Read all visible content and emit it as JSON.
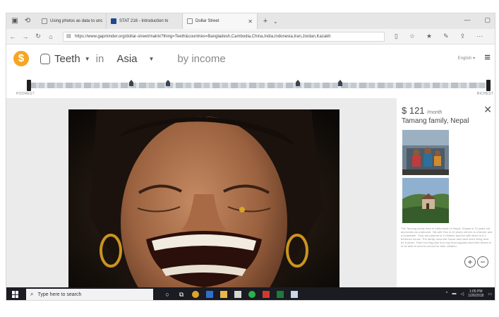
{
  "browser": {
    "tabs": [
      {
        "title": "Using photos as data to unc"
      },
      {
        "title": "STAT 216 - Introduction to"
      },
      {
        "title": "Dollar Street",
        "active": true
      }
    ],
    "url": "https://www.gapminder.org/dollar-street/matrix?thing=Teeth&countries=Bangladesh,Cambodia,China,India,Indonesia,Iran,Jordan,Kazakh"
  },
  "header": {
    "logo": "$",
    "thing": "Teeth",
    "in_label": "in",
    "place": "Asia",
    "by_income": "by income",
    "language": "English",
    "language_caret": "▾"
  },
  "slider": {
    "poorest": "POOREST",
    "richest": "RICHEST"
  },
  "panel": {
    "price": "$ 121",
    "per_month": "/month",
    "family": "Tamang family, Nepal",
    "description": "The Tamang family lives in Kathmandu in Nepal. Dhyani is 70 years old and works as a labourer. His wife Hiru is 40 years old she is a farmer and a housewife. They are parents to 3 children and live with them in a 2 bedroom house. The family owns the house and have been living here for 5 years. Their next big plan is to buy food supplies and their dream is to be able to send to school for their children.",
    "zoom_in": "+",
    "zoom_out": "−"
  },
  "taskbar": {
    "search_placeholder": "Type here to search",
    "time": "1:05 PM",
    "date": "1/26/2018"
  },
  "colors": {
    "logo": "#f5a623",
    "taskbar": "#1b1b22",
    "slider_handle": "#1f1f1f"
  },
  "icons": [
    "back-icon",
    "forward-icon",
    "refresh-icon",
    "home-icon",
    "lock-icon",
    "reading-view-icon",
    "favorite-star-icon",
    "favorites-icon",
    "notes-icon",
    "share-icon",
    "tooth-icon",
    "hamburger-menu-icon",
    "close-icon",
    "windows-start-icon",
    "search-icon"
  ]
}
